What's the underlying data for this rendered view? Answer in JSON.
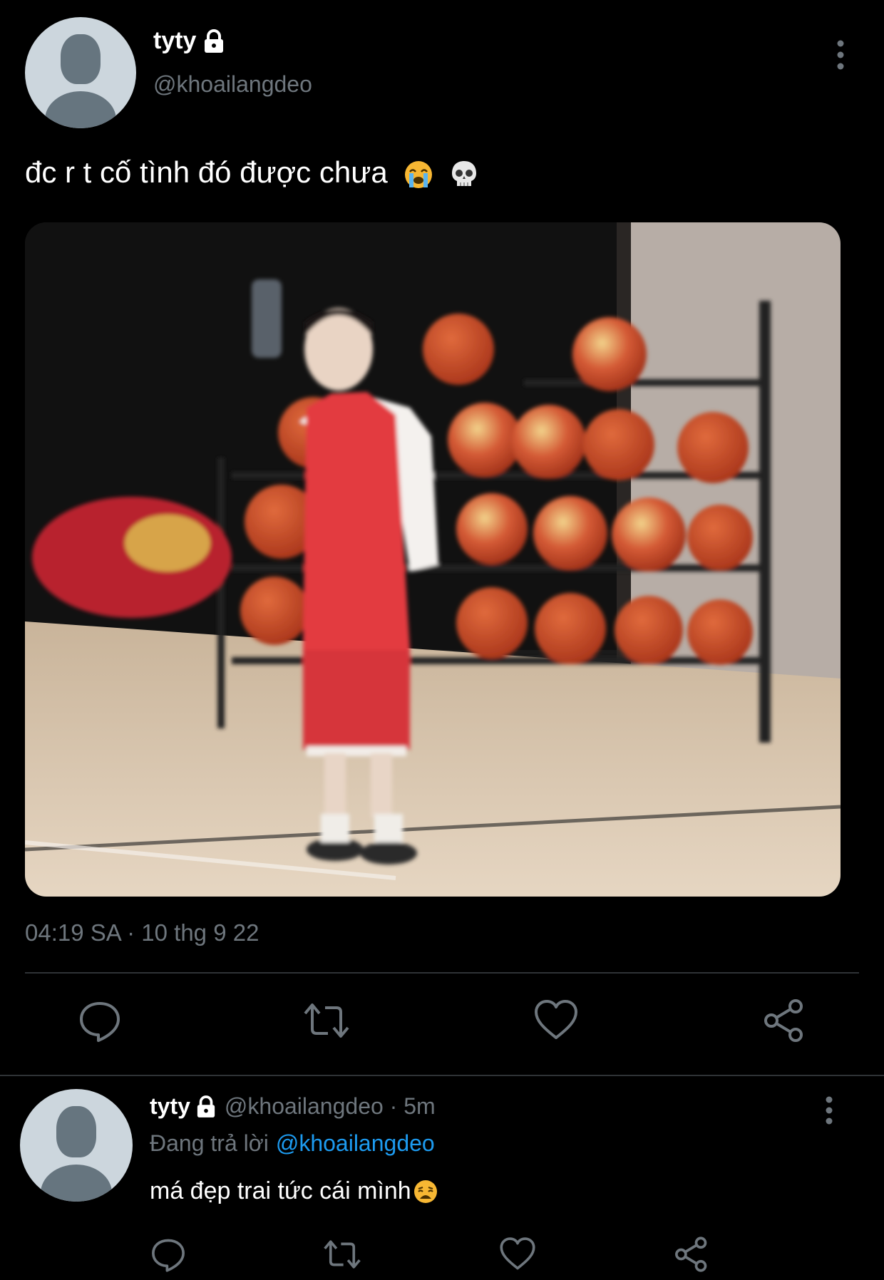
{
  "tweet": {
    "author": {
      "display_name": "tyty",
      "handle": "@khoailangdeo",
      "protected": true
    },
    "text": "đc r t cố tình đó được chưa",
    "emojis": [
      "loudly-crying-face",
      "skull"
    ],
    "timestamp": "04:19 SA · 10 thg 9 22",
    "media": {
      "type": "photo",
      "scene": "basketball-court-with-ball-rack"
    },
    "actions": [
      "reply-icon",
      "retweet-icon",
      "like-icon",
      "share-icon"
    ]
  },
  "reply": {
    "author": {
      "display_name": "tyty",
      "protected": true
    },
    "meta": "@khoailangdeo · 5m",
    "replying_label": "Đang trả lời",
    "replying_to": "@khoailangdeo",
    "text": "má đẹp trai tức cái mình",
    "emoji": "weary-face",
    "actions": [
      "reply-icon",
      "retweet-icon",
      "like-icon",
      "share-icon"
    ]
  },
  "colors": {
    "background": "#000000",
    "text_primary": "#ffffff",
    "text_secondary": "#6e767d",
    "link": "#1d9bf0",
    "divider": "#2f3336"
  }
}
